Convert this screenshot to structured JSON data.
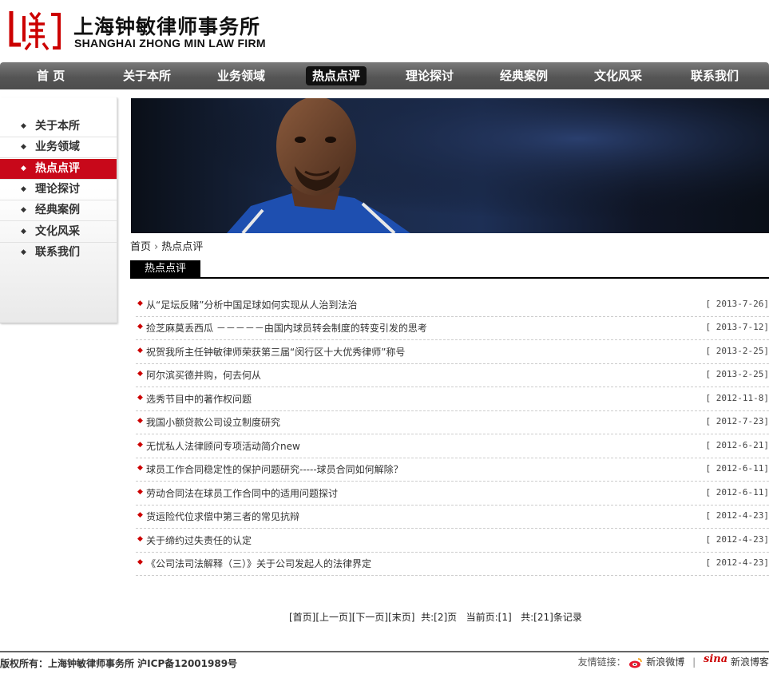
{
  "header": {
    "logo_cn": "上海钟敏律师事务所",
    "logo_en": "SHANGHAI ZHONG MIN LAW FIRM"
  },
  "nav": {
    "items": [
      {
        "label": "首 页"
      },
      {
        "label": "关于本所"
      },
      {
        "label": "业务领域"
      },
      {
        "label": "热点点评",
        "active": true
      },
      {
        "label": "理论探讨"
      },
      {
        "label": "经典案例"
      },
      {
        "label": "文化风采"
      },
      {
        "label": "联系我们"
      }
    ]
  },
  "sidebar": {
    "bullet": "◆",
    "items": [
      {
        "label": "关于本所"
      },
      {
        "label": "业务领域"
      },
      {
        "label": "热点点评",
        "active": true
      },
      {
        "label": "理论探讨"
      },
      {
        "label": "经典案例"
      },
      {
        "label": "文化风采"
      },
      {
        "label": "联系我们"
      }
    ]
  },
  "breadcrumb": {
    "home": "首页",
    "sep": "›",
    "current": "热点点评"
  },
  "section": {
    "title": "热点点评"
  },
  "news": {
    "bullet": "◆",
    "items": [
      {
        "title": "从“足坛反赌”分析中国足球如何实现从人治到法治",
        "date": "[ 2013-7-26]"
      },
      {
        "title": "捡芝麻莫丢西瓜 －－－－－由国内球员转会制度的转变引发的思考",
        "date": "[ 2013-7-12]"
      },
      {
        "title": "祝贺我所主任钟敏律师荣获第三届“闵行区十大优秀律师”称号",
        "date": "[ 2013-2-25]"
      },
      {
        "title": "阿尔滨买德并购，何去何从",
        "date": "[ 2013-2-25]"
      },
      {
        "title": "选秀节目中的著作权问题",
        "date": "[ 2012-11-8]"
      },
      {
        "title": "我国小额贷款公司设立制度研究",
        "date": "[ 2012-7-23]"
      },
      {
        "title": "无忧私人法律顾问专项活动简介new",
        "date": "[ 2012-6-21]"
      },
      {
        "title": "球员工作合同稳定性的保护问题研究-----球员合同如何解除？",
        "date": "[ 2012-6-11]"
      },
      {
        "title": "劳动合同法在球员工作合同中的适用问题探讨",
        "date": "[ 2012-6-11]"
      },
      {
        "title": "货运险代位求偿中第三者的常见抗辩",
        "date": "[ 2012-4-23]"
      },
      {
        "title": "关于缔约过失责任的认定",
        "date": "[ 2012-4-23]"
      },
      {
        "title": "《公司法司法解释（三）》关于公司发起人的法律界定",
        "date": "[ 2012-4-23]"
      }
    ]
  },
  "pager": {
    "first": "[首页]",
    "prev": "[上一页]",
    "next": "[下一页]",
    "last": "[末页]",
    "total_pages": "共:[2]页",
    "current_page": "当前页:[1]",
    "total_records": "共:[21]条记录"
  },
  "footer": {
    "copyright": "版权所有：上海钟敏律师事务所 沪ICP备12001989号",
    "friend_label": "友情链接：",
    "links": [
      {
        "label": "新浪微博",
        "icon": "weibo-icon"
      },
      {
        "label": "新浪博客",
        "icon": "sina-icon"
      }
    ],
    "divider": "|",
    "sina_logo_text": "sina"
  },
  "colors": {
    "accent_red": "#c8081a",
    "nav_bg": "#555555",
    "active_nav": "#111111"
  }
}
